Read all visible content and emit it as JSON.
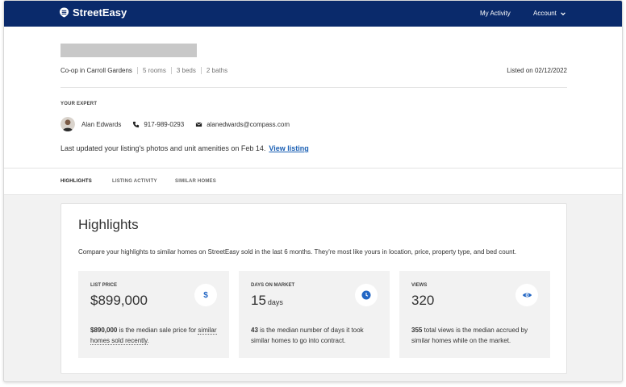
{
  "nav": {
    "brand": "StreetEasy",
    "my_activity": "My Activity",
    "account": "Account"
  },
  "listing": {
    "type": "Co-op in Carroll Gardens",
    "rooms": "5 rooms",
    "beds": "3 beds",
    "baths": "2 baths",
    "listed": "Listed on 02/12/2022"
  },
  "expert": {
    "label": "YOUR EXPERT",
    "name": "Alan Edwards",
    "phone": "917-989-0293",
    "email": "alanedwards@compass.com"
  },
  "update": {
    "text": "Last updated your listing's photos and unit amenities on Feb 14.",
    "link": "View listing"
  },
  "tabs": [
    "HIGHLIGHTS",
    "LISTING ACTIVITY",
    "SIMILAR HOMES"
  ],
  "highlights": {
    "title": "Highlights",
    "description": "Compare your highlights to similar homes on StreetEasy sold in the last 6 months. They're most like yours in location, price, property type, and bed count.",
    "stats": [
      {
        "label": "LIST PRICE",
        "value": "$899,000",
        "unit": "",
        "icon": "dollar-icon",
        "bold": "$890,000",
        "rest": " is the median sale price for ",
        "link": "similar homes sold recently",
        "after": "."
      },
      {
        "label": "DAYS ON MARKET",
        "value": "15",
        "unit": "days",
        "icon": "clock-icon",
        "bold": "43",
        "rest": " is the median number of days it took similar homes to go into contract.",
        "link": "",
        "after": ""
      },
      {
        "label": "VIEWS",
        "value": "320",
        "unit": "",
        "icon": "eye-icon",
        "bold": "355",
        "rest": " total views is the median accrued by similar homes while on the market.",
        "link": "",
        "after": ""
      }
    ]
  },
  "colors": {
    "nav": "#0a2a6b",
    "accent": "#2266c4",
    "link": "#1a5fb4"
  }
}
